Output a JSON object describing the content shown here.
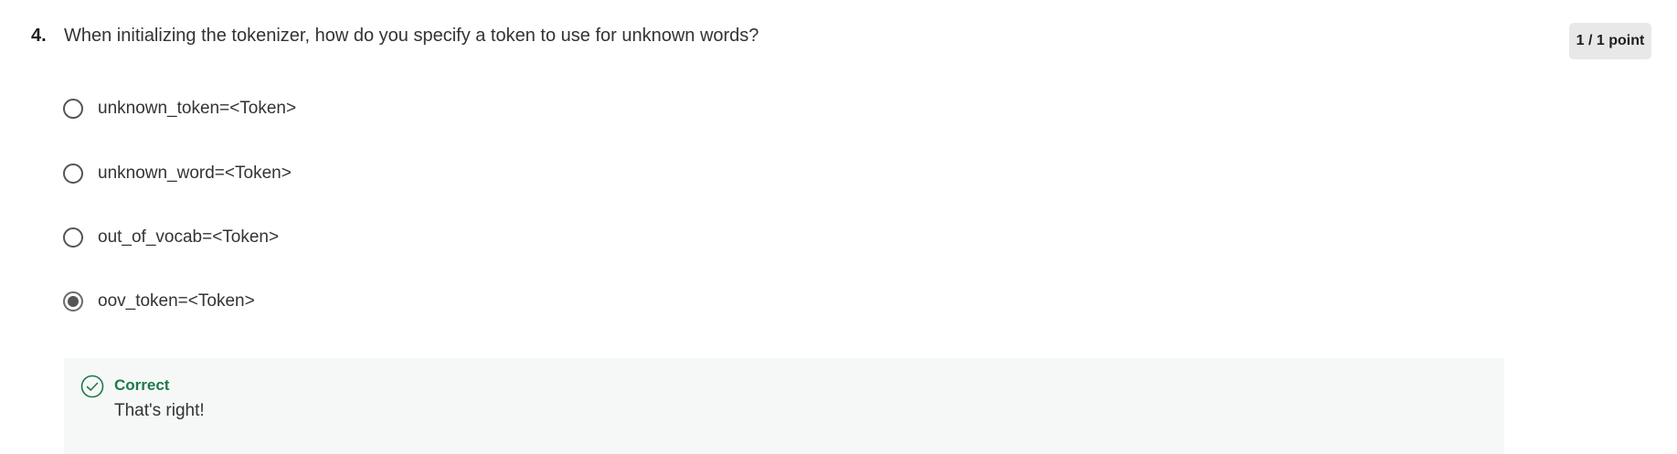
{
  "question": {
    "number": "4.",
    "text": "When initializing the tokenizer, how do you specify a token to use for unknown words?",
    "score": "1 / 1 point"
  },
  "options": [
    {
      "label": "unknown_token=<Token>",
      "selected": false
    },
    {
      "label": "unknown_word=<Token>",
      "selected": false
    },
    {
      "label": "out_of_vocab=<Token>",
      "selected": false
    },
    {
      "label": "oov_token=<Token>",
      "selected": true
    }
  ],
  "feedback": {
    "title": "Correct",
    "message": "That's right!",
    "icon": "check-circle-icon"
  },
  "colors": {
    "correct": "#1e7a4a",
    "feedback_bg": "#f5f8f7",
    "badge_bg": "#e8e8e8"
  }
}
